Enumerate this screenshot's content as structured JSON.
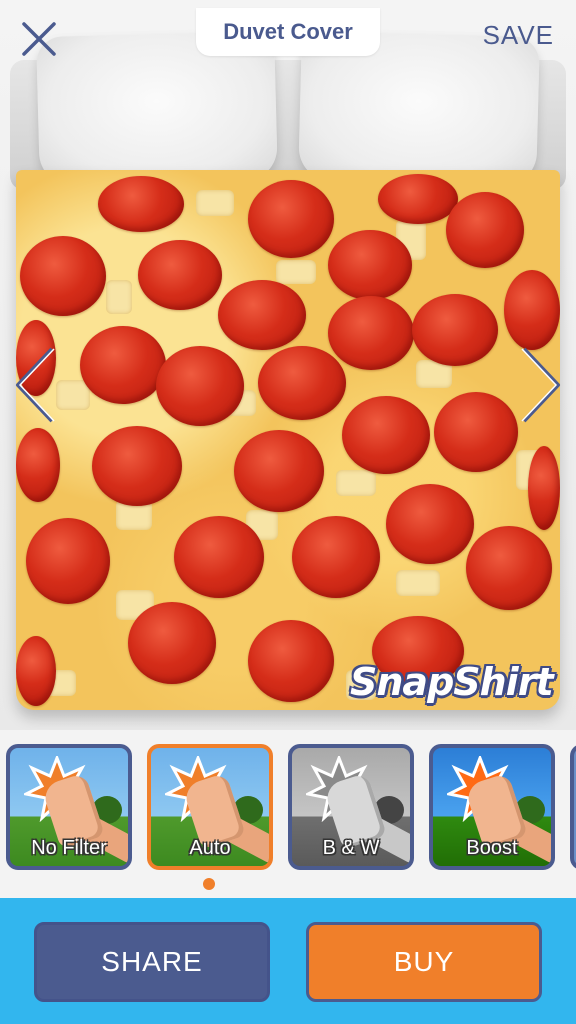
{
  "header": {
    "title": "Duvet Cover",
    "save_label": "SAVE",
    "close_icon": "close-icon"
  },
  "preview": {
    "product": "duvet cover",
    "watermark": "SnapShirt",
    "prev_icon": "chevron-left-icon",
    "next_icon": "chevron-right-icon"
  },
  "filters": {
    "items": [
      {
        "label": "No Filter",
        "selected": false
      },
      {
        "label": "Auto",
        "selected": true
      },
      {
        "label": "B & W",
        "selected": false
      },
      {
        "label": "Boost",
        "selected": false
      }
    ],
    "current_page": 1
  },
  "actions": {
    "share_label": "SHARE",
    "buy_label": "BUY"
  },
  "colors": {
    "accent_navy": "#4b5b8f",
    "accent_orange": "#f07f2a",
    "action_bar_blue": "#32b6ee"
  }
}
